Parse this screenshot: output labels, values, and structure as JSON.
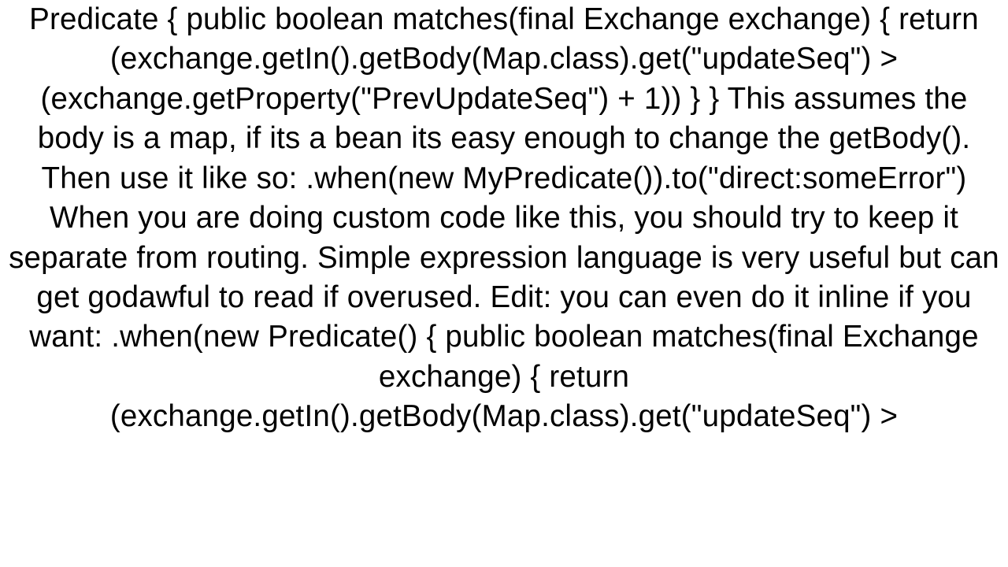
{
  "text": "Predicate {    public boolean matches(final Exchange exchange) {      return (exchange.getIn().getBody(Map.class).get(\"updateSeq\") > (exchange.getProperty(\"PrevUpdateSeq\") + 1))   } }  This assumes the body is a map, if its a bean its easy enough to change the getBody(). Then use it like so:  .when(new MyPredicate()).to(\"direct:someError\")  When you are doing custom code like this, you should try to keep it separate from routing. Simple expression language is very useful but can get godawful to read if overused.   Edit: you can even do it inline if you want:  .when(new Predicate() {    public boolean matches(final Exchange exchange) {      return (exchange.getIn().getBody(Map.class).get(\"updateSeq\") >"
}
